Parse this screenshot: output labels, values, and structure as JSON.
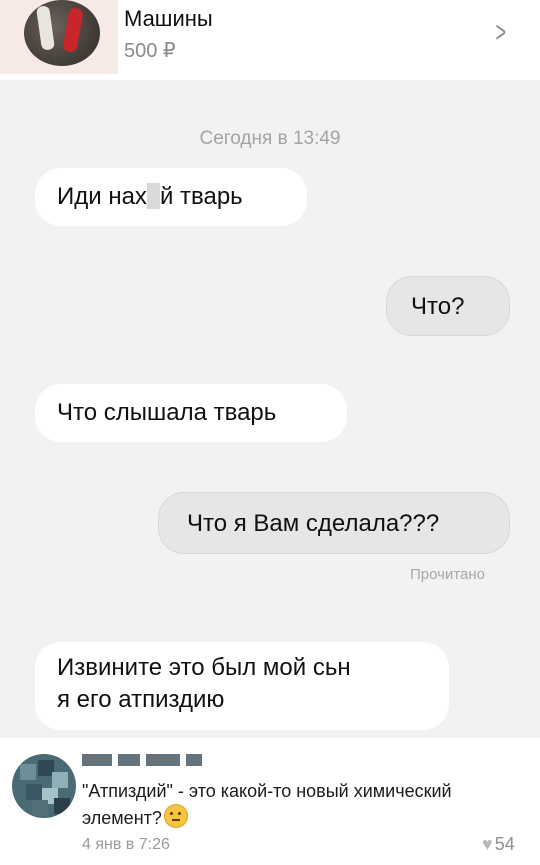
{
  "header": {
    "title": "Машины",
    "price": "500 ₽",
    "thumb_icon": "toy-cars-photo",
    "chevron_icon": "chevron-right-icon"
  },
  "chat": {
    "date": "Сегодня в 13:49",
    "messages": [
      {
        "side": "in",
        "pre": "Иди нах",
        "post": "й тварь"
      },
      {
        "side": "out",
        "text": "Что?"
      },
      {
        "side": "in",
        "text": "Что слышала тварь"
      },
      {
        "side": "out",
        "text": "Что я Вам сделала???"
      },
      {
        "side": "in",
        "line1": "Извините это был мой сьн",
        "line2": "я его атпиздию"
      }
    ],
    "read_status": "Прочитано"
  },
  "comment": {
    "text": "\"Атпиздий\" - это какой-то новый химический элемент?",
    "emoji": "thinking-face-icon",
    "date": "4 янв в 7:26",
    "likes": "54",
    "like_icon": "heart-icon"
  }
}
